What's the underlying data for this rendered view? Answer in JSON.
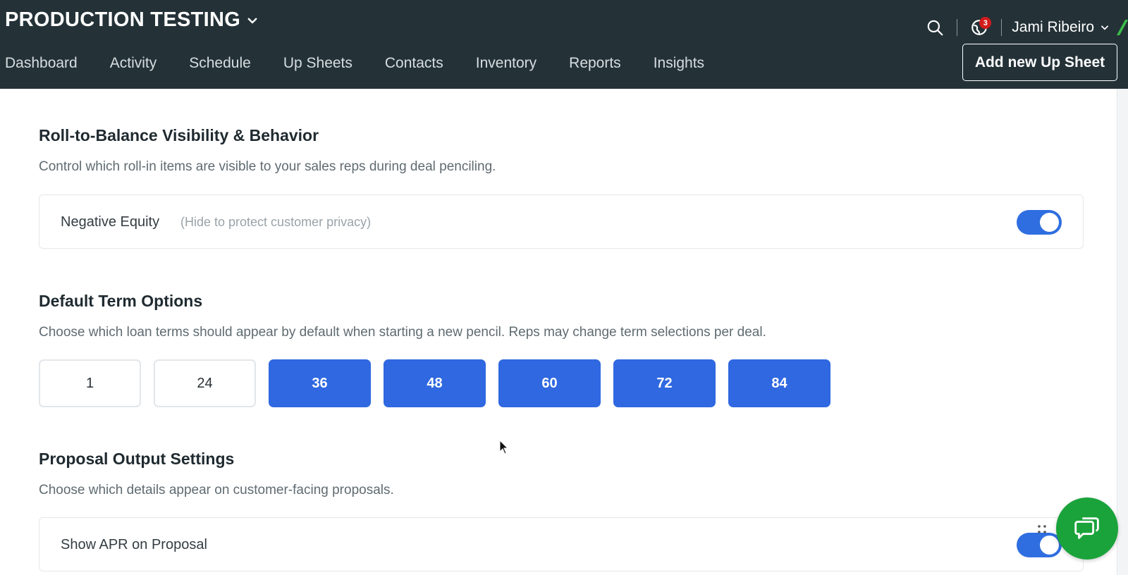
{
  "header": {
    "org_name": "PRODUCTION TESTING",
    "notification_count": "3",
    "user_name": "Jami Ribeiro",
    "add_button_label": "Add new Up Sheet"
  },
  "nav": {
    "items": [
      {
        "label": "Dashboard"
      },
      {
        "label": "Activity"
      },
      {
        "label": "Schedule"
      },
      {
        "label": "Up Sheets"
      },
      {
        "label": "Contacts"
      },
      {
        "label": "Inventory"
      },
      {
        "label": "Reports"
      },
      {
        "label": "Insights"
      }
    ]
  },
  "roll_to_balance": {
    "title": "Roll-to-Balance Visibility & Behavior",
    "description": "Control which roll-in items are visible to your sales reps during deal penciling.",
    "negative_equity": {
      "label": "Negative Equity",
      "hint": "(Hide to protect customer privacy)",
      "enabled": true
    }
  },
  "term_options": {
    "title": "Default Term Options",
    "description": "Choose which loan terms should appear by default when starting a new pencil. Reps may change term selections per deal.",
    "terms": [
      {
        "value": "1",
        "selected": false
      },
      {
        "value": "24",
        "selected": false
      },
      {
        "value": "36",
        "selected": true
      },
      {
        "value": "48",
        "selected": true
      },
      {
        "value": "60",
        "selected": true
      },
      {
        "value": "72",
        "selected": true
      },
      {
        "value": "84",
        "selected": true
      }
    ]
  },
  "proposal_output": {
    "title": "Proposal Output Settings",
    "description": "Choose which details appear on customer-facing proposals.",
    "show_apr": {
      "label": "Show APR on Proposal",
      "enabled": true
    }
  },
  "colors": {
    "topbar": "#243238",
    "accent_blue": "#2f68e0",
    "chat_green": "#1aa33a",
    "badge_red": "#d11b1b"
  },
  "icons": {
    "search": "search-icon",
    "notifications": "globe-notification-icon",
    "chat": "chat-icon"
  }
}
